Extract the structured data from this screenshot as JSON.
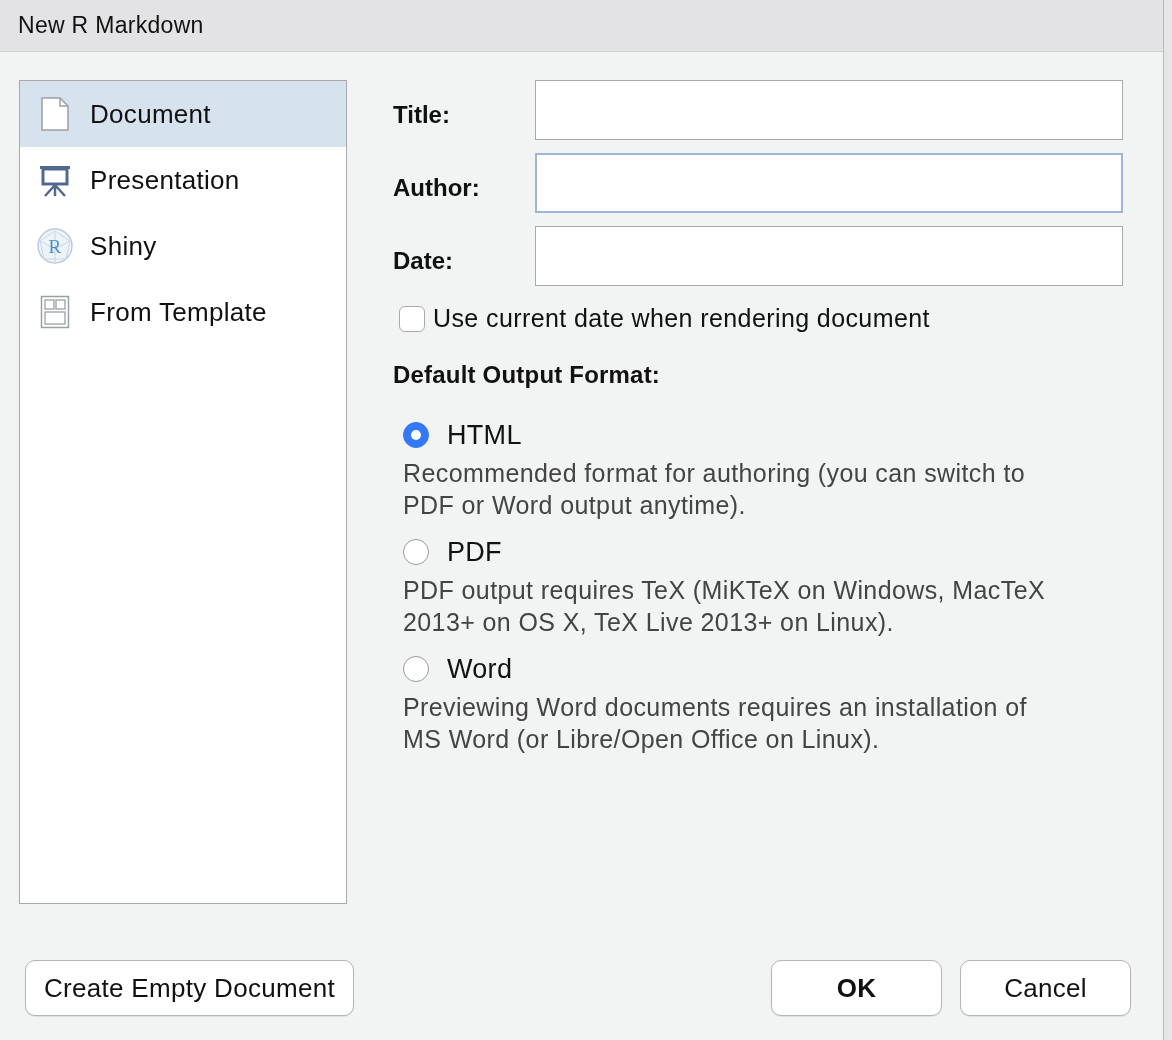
{
  "window": {
    "title": "New R Markdown"
  },
  "sidebar": {
    "items": [
      {
        "label": "Document",
        "kind": "document",
        "selected": true
      },
      {
        "label": "Presentation",
        "kind": "presentation",
        "selected": false
      },
      {
        "label": "Shiny",
        "kind": "shiny",
        "icon_letter": "R",
        "selected": false
      },
      {
        "label": "From Template",
        "kind": "template",
        "selected": false
      }
    ]
  },
  "fields": [
    {
      "label": "Title:",
      "focused": false
    },
    {
      "label": "Author:",
      "focused": true
    },
    {
      "label": "Date:",
      "focused": false
    }
  ],
  "use_current_date": {
    "label": "Use current date when rendering document",
    "checked": false
  },
  "output_format": {
    "heading": "Default Output Format:",
    "options": [
      {
        "label": "HTML",
        "description": "Recommended format for authoring (you can switch to PDF or Word output anytime).",
        "selected": true
      },
      {
        "label": "PDF",
        "description": "PDF output requires TeX (MiKTeX on Windows, MacTeX 2013+ on OS X, TeX Live 2013+ on Linux).",
        "selected": false
      },
      {
        "label": "Word",
        "description": "Previewing Word documents requires an installation of MS Word (or Libre/Open Office on Linux).",
        "selected": false
      }
    ]
  },
  "buttons": {
    "left": [
      {
        "label": "Create Empty Document",
        "default": false
      }
    ],
    "right": [
      {
        "label": "OK",
        "default": true
      },
      {
        "label": "Cancel",
        "default": false
      }
    ]
  }
}
